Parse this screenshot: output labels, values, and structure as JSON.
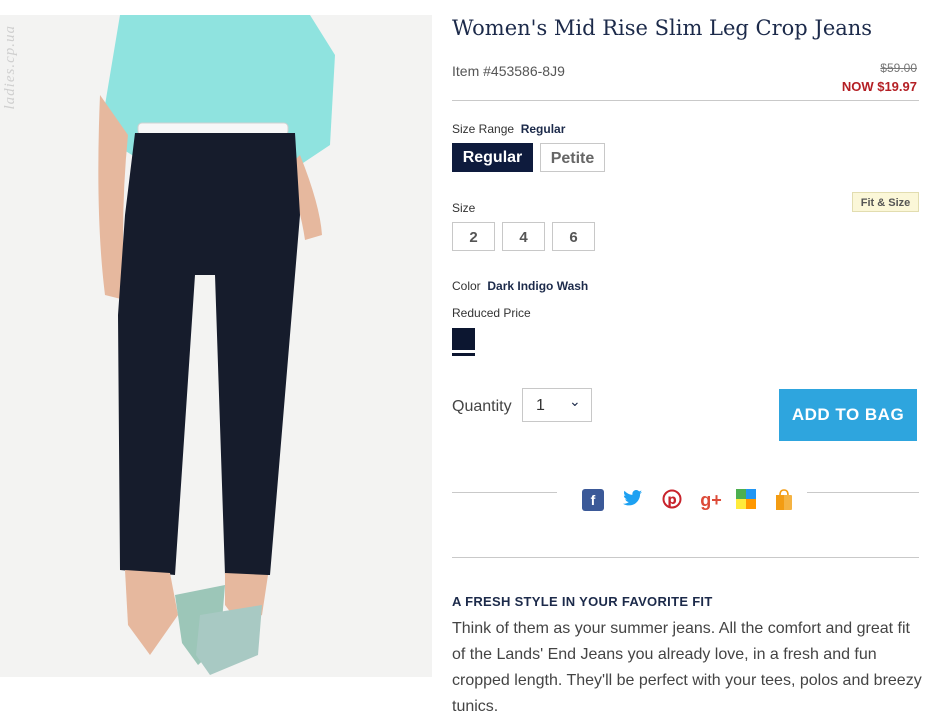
{
  "watermark": "ladies.cp.ua",
  "product": {
    "title": "Women's Mid Rise Slim Leg Crop Jeans",
    "item_number": "Item #453586-8J9",
    "price_original": "$59.00",
    "price_now": "NOW $19.97"
  },
  "size_range": {
    "label": "Size Range",
    "selected": "Regular",
    "options": [
      "Regular",
      "Petite"
    ]
  },
  "size": {
    "label": "Size",
    "options": [
      "2",
      "4",
      "6"
    ],
    "fit_link": "Fit & Size"
  },
  "color": {
    "label": "Color",
    "selected": "Dark Indigo Wash",
    "group_label": "Reduced Price",
    "swatch_hex": "#0c1630"
  },
  "quantity": {
    "label": "Quantity",
    "value": "1"
  },
  "add_to_bag": "ADD TO BAG",
  "social": [
    "facebook-icon",
    "twitter-icon",
    "pinterest-icon",
    "google-plus-icon",
    "shared-icon",
    "gift-icon"
  ],
  "description": {
    "heading": "A FRESH STYLE IN YOUR FAVORITE FIT",
    "body": "Think of them as your summer jeans. All the comfort and great fit of the Lands' End Jeans you already love, in a fresh and fun cropped length. They'll be perfect with your tees, polos and breezy tunics."
  },
  "colors": {
    "navy": "#0e1b3d",
    "accent_blue": "#2ea5de",
    "sale_red": "#b41f24"
  }
}
